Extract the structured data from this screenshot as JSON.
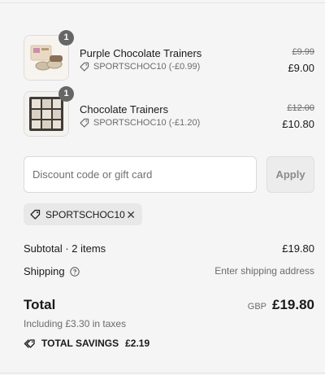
{
  "line_items": [
    {
      "name": "Purple Chocolate Trainers",
      "quantity": "1",
      "discount": "SPORTSCHOC10 (-£0.99)",
      "original_price": "£9.99",
      "price": "£9.00",
      "image": "purple-chocolate-trainers-thumbnail"
    },
    {
      "name": "Chocolate Trainers",
      "quantity": "1",
      "discount": "SPORTSCHOC10 (-£1.20)",
      "original_price": "£12.00",
      "price": "£10.80",
      "image": "chocolate-trainers-thumbnail"
    }
  ],
  "discount_form": {
    "placeholder": "Discount code or gift card",
    "apply_label": "Apply"
  },
  "applied_code": {
    "code": "SPORTSCHOC10",
    "remove_icon": "close-icon"
  },
  "summary": {
    "subtotal_label": "Subtotal · 2 items",
    "subtotal_value": "£19.80",
    "shipping_label": "Shipping",
    "shipping_value": "Enter shipping address",
    "total_label": "Total",
    "currency": "GBP",
    "total_value": "£19.80",
    "taxes_note": "Including £3.30 in taxes",
    "savings_label": "TOTAL SAVINGS",
    "savings_value": "£2.19"
  },
  "colors": {
    "background": "#f5f5f5",
    "badge": "#666666",
    "muted_text": "#6b6b6b",
    "chip": "#e8e8e8"
  }
}
